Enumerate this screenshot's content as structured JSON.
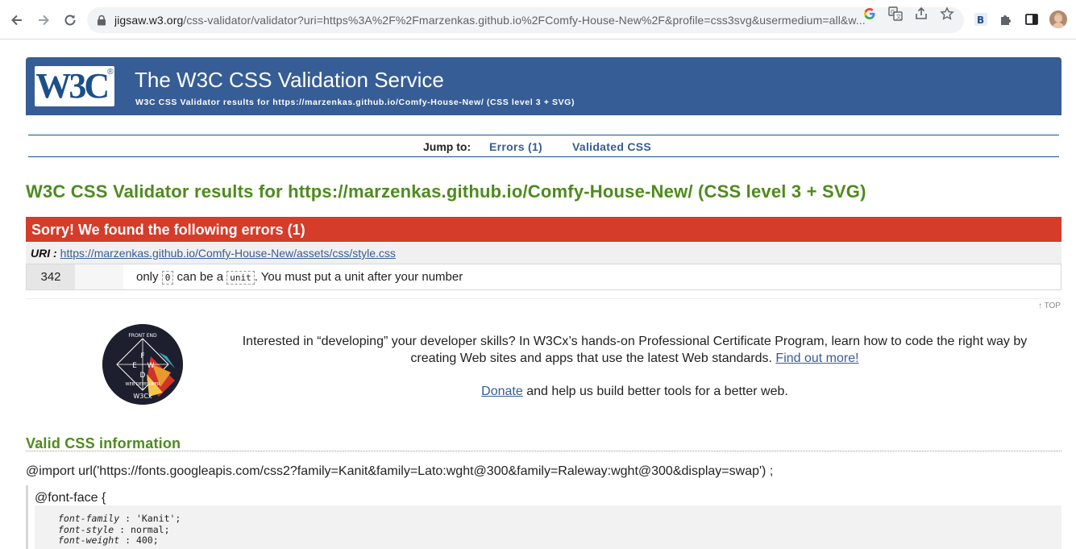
{
  "browser": {
    "url_host": "jigsaw.w3.org",
    "url_rest": "/css-validator/validator?uri=https%3A%2F%2Fmarzenkas.github.io%2FComfy-House-New%2F&profile=css3svg&usermedium=all&w..."
  },
  "header": {
    "logo": "W3C",
    "logo_reg": "®",
    "title": "The W3C CSS Validation Service",
    "subtitle": "W3C CSS Validator results for https://marzenkas.github.io/Comfy-House-New/ (CSS level 3 + SVG)"
  },
  "jump": {
    "label": "Jump to:",
    "errors_link": "Errors (1)",
    "validated_link": "Validated CSS"
  },
  "results_title": "W3C CSS Validator results for https://marzenkas.github.io/Comfy-House-New/ (CSS level 3 + SVG)",
  "errors": {
    "heading": "Sorry! We found the following errors (1)",
    "uri_label": "URI :",
    "uri": "https://marzenkas.github.io/Comfy-House-New/assets/css/style.css",
    "rows": [
      {
        "line": "342",
        "msg_prefix": "only",
        "code1": "0",
        "msg_mid": "can be a",
        "code2": "unit",
        "msg_suffix": ". You must put a unit after your number"
      }
    ]
  },
  "top_link": "↑ TOP",
  "promo": {
    "text": "Interested in “developing” your developer skills? In W3Cx’s hands-on Professional Certificate Program, learn how to code the right way by creating Web sites and apps that use the latest Web standards.",
    "link": "Find out more!",
    "donate_link": "Donate",
    "donate_text": "and help us build better tools for a better web.",
    "badge_lines": [
      "FRONT END",
      "WEB DEVELOPER",
      "W3Cx"
    ]
  },
  "valid_css": {
    "title": "Valid CSS information",
    "import_line": "@import url('https://fonts.googleapis.com/css2?family=Kanit&family=Lato:wght@300&family=Raleway:wght@300&display=swap') ;",
    "block_head": "@font-face {",
    "props": [
      {
        "name": "font-family",
        "value": "'Kanit';"
      },
      {
        "name": "font-style",
        "value": "normal;"
      },
      {
        "name": "font-weight",
        "value": "400;"
      }
    ]
  },
  "colors": {
    "banner": "#365d95",
    "error": "#d53c2a",
    "green": "#4d8b1d"
  }
}
